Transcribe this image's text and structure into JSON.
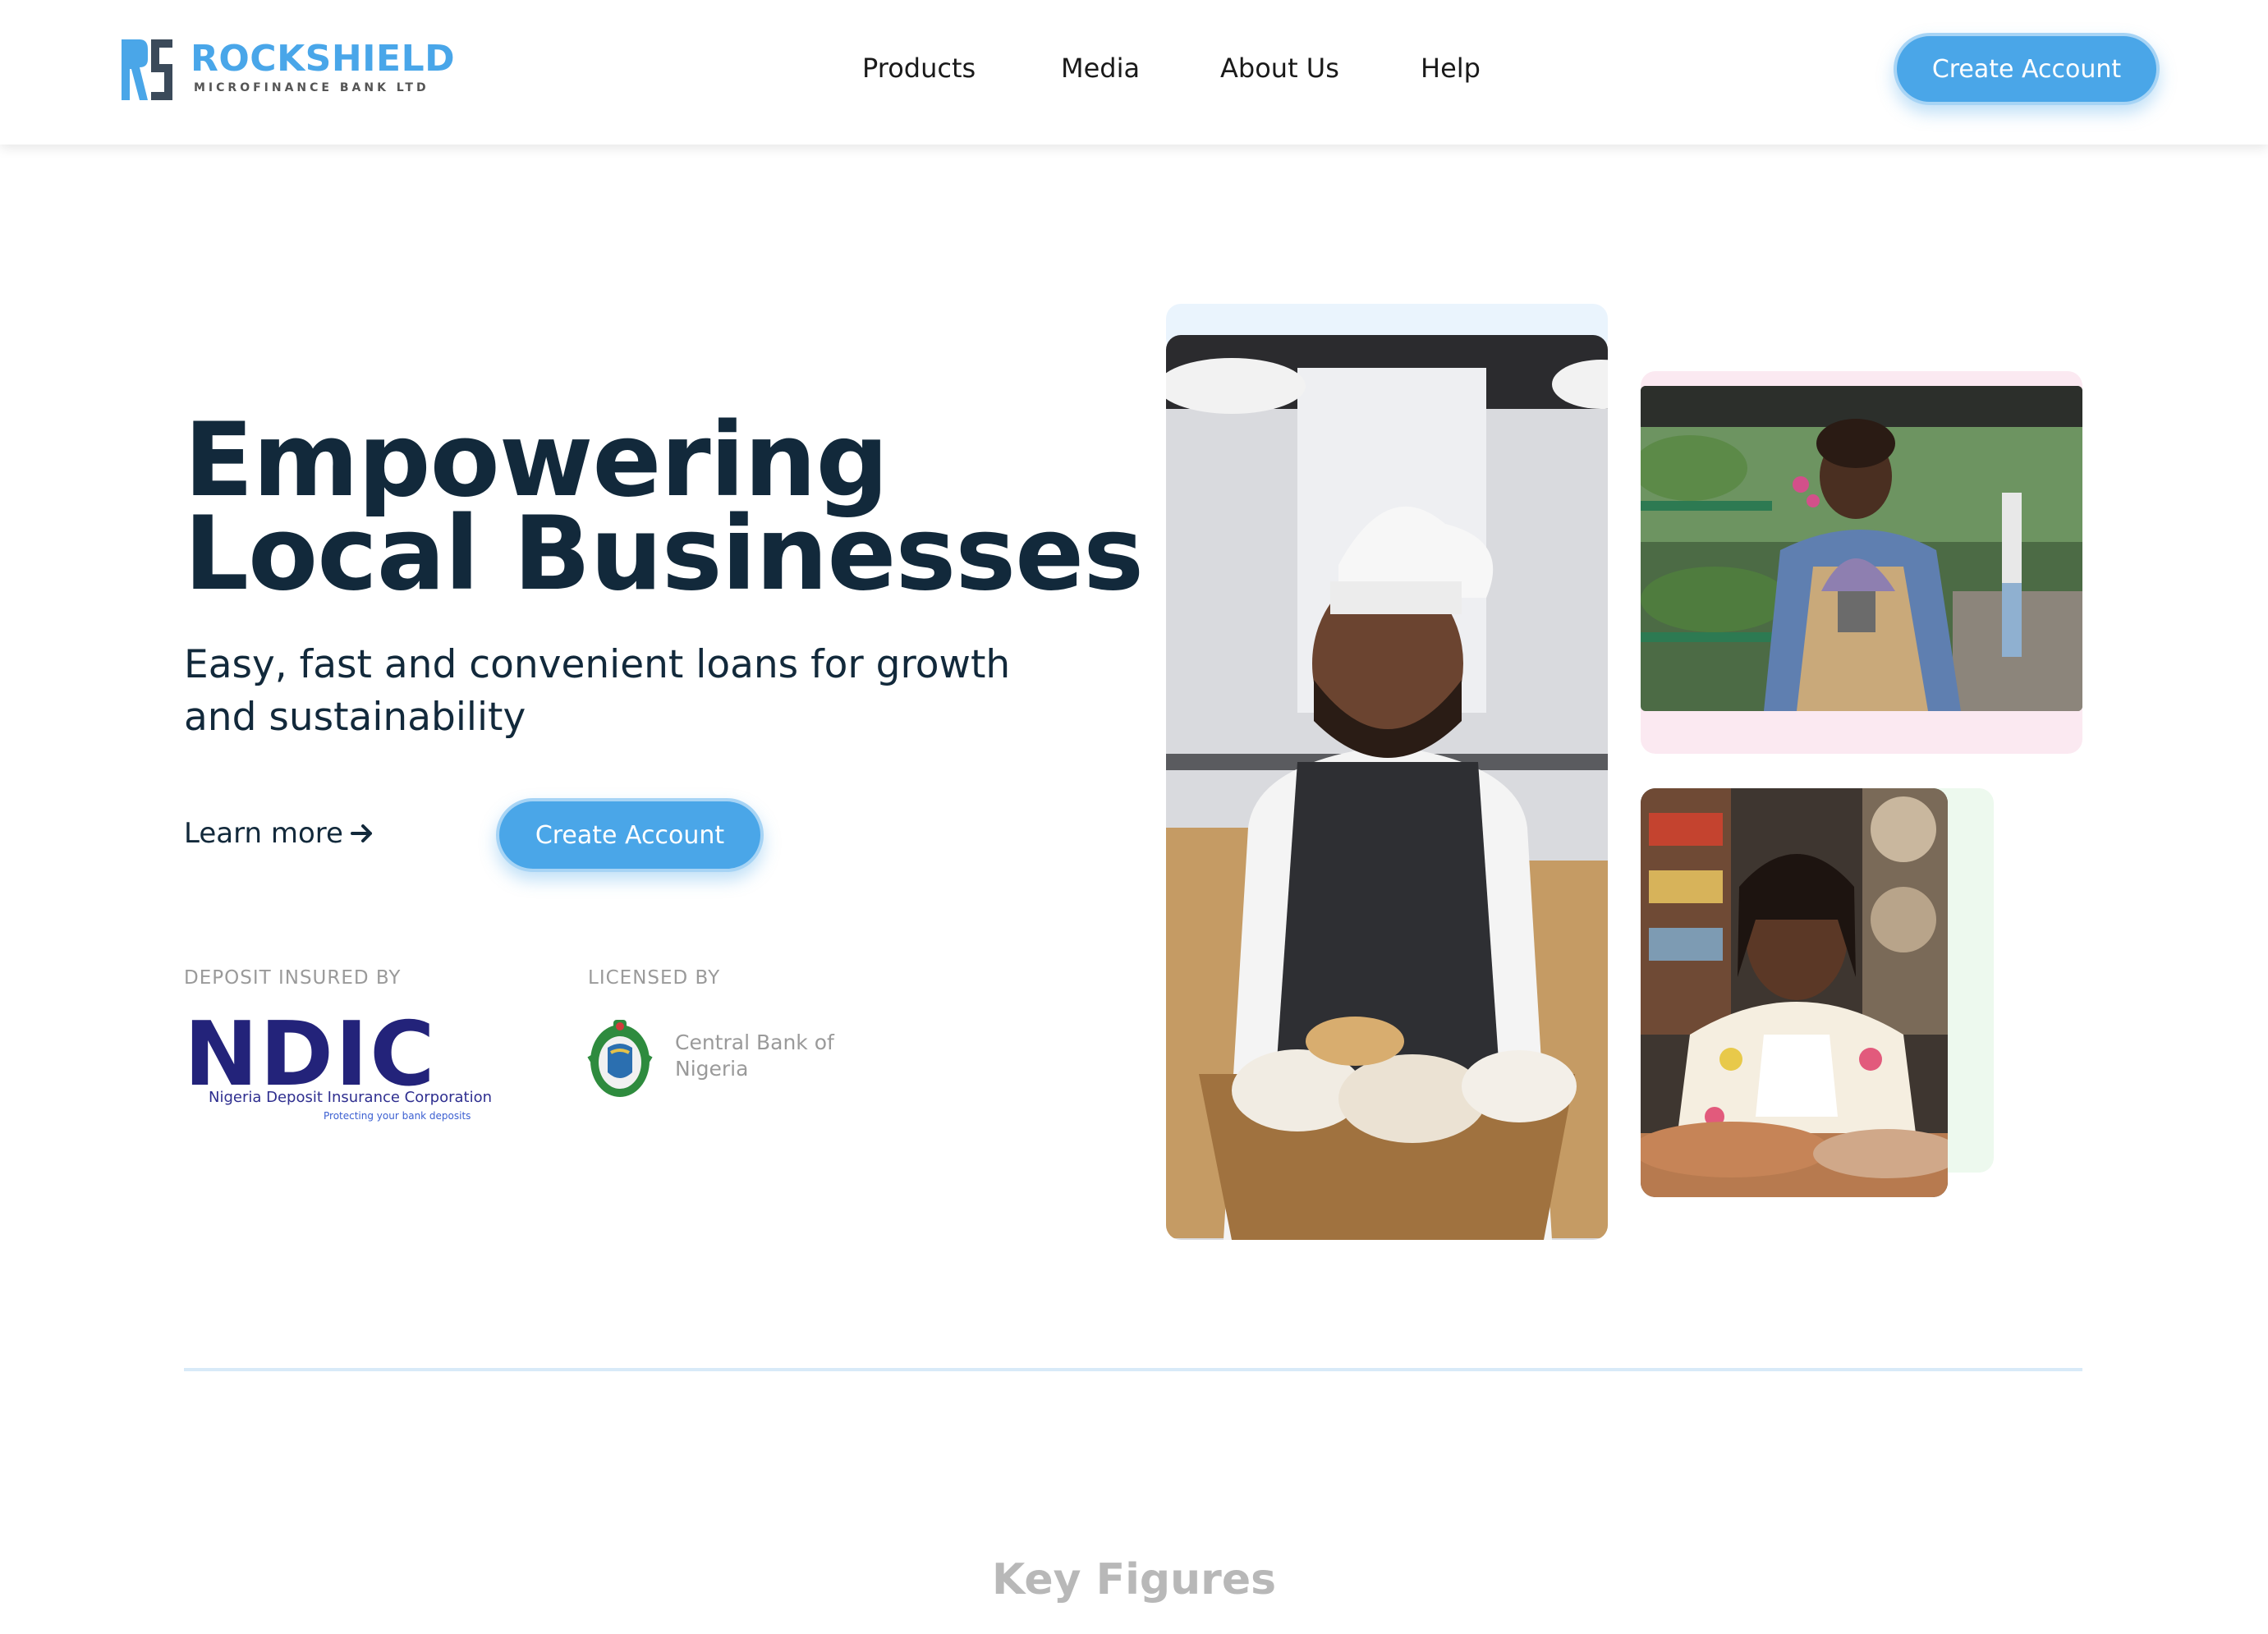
{
  "brand": {
    "name": "ROCKSHIELD",
    "subtitle": "MICROFINANCE BANK LTD",
    "primary_color": "#4aa6e8",
    "text_color": "#12293b"
  },
  "nav": {
    "links": [
      "Products",
      "Media",
      "About Us",
      "Help"
    ],
    "cta_label": "Create Account"
  },
  "hero": {
    "title_line1": "Empowering",
    "title_line2": "Local Businesses",
    "subtitle": "Easy, fast and convenient loans for growth and sustainability",
    "learn_more_label": "Learn more",
    "learn_more_icon": "arrow-right-icon",
    "cta_label": "Create Account"
  },
  "trust": {
    "deposit_label": "DEPOSIT INSURED BY",
    "licensed_label": "LICENSED BY",
    "ndic_word": "NDIC",
    "ndic_line1": "Nigeria Deposit Insurance Corporation",
    "ndic_line2": "Protecting your bank deposits",
    "cbn_name": "Central Bank of Nigeria"
  },
  "section": {
    "key_figures_title": "Key Figures"
  }
}
